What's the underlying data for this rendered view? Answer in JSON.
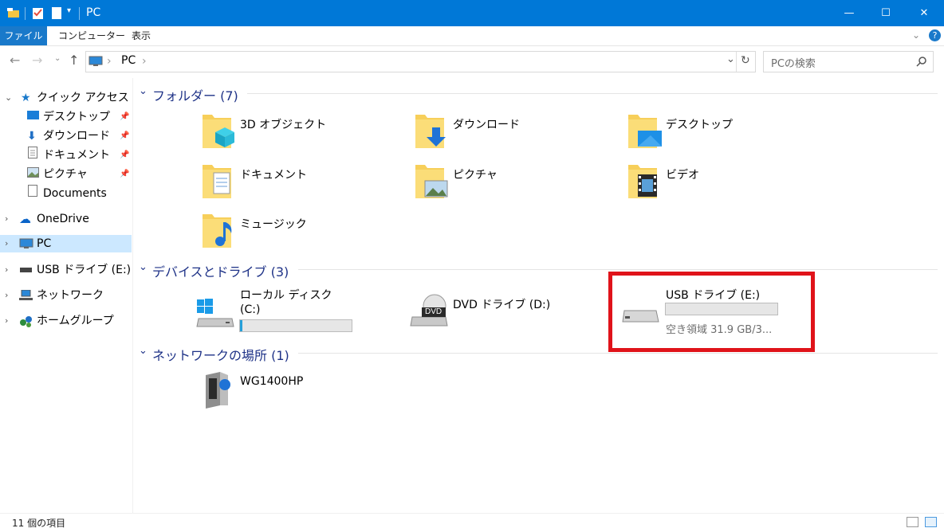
{
  "window": {
    "title": "PC",
    "minimize": "—",
    "maximize": "☐",
    "close": "✕"
  },
  "ribbon": {
    "tabs": [
      "ファイル",
      "コンピューター",
      "表示"
    ]
  },
  "address": {
    "location": "PC",
    "separator": "›",
    "search_placeholder": "PCの検索"
  },
  "nav": {
    "quick_access": "クイック アクセス",
    "items": [
      "デスクトップ",
      "ダウンロード",
      "ドキュメント",
      "ピクチャ",
      "Documents"
    ],
    "onedrive": "OneDrive",
    "pc": "PC",
    "usb": "USB ドライブ (E:)",
    "network": "ネットワーク",
    "homegroup": "ホームグループ"
  },
  "groups": {
    "folders_header": "フォルダー (7)",
    "devices_header": "デバイスとドライブ (3)",
    "network_header": "ネットワークの場所 (1)"
  },
  "folders": [
    "3D オブジェクト",
    "ダウンロード",
    "デスクトップ",
    "ドキュメント",
    "ピクチャ",
    "ビデオ",
    "ミュージック"
  ],
  "drives": {
    "local_name": "ローカル ディスク",
    "local_letter": "(C:)",
    "local_fill_pct": 2,
    "dvd_name": "DVD ドライブ (D:)",
    "dvd_badge": "DVD",
    "usb_name": "USB ドライブ (E:)",
    "usb_free": "空き領域 31.9 GB/3...",
    "usb_fill_pct": 0
  },
  "network_locations": [
    "WG1400HP"
  ],
  "status": {
    "count": "11 個の項目"
  },
  "colors": {
    "accent": "#0078d7",
    "highlight": "#e0131a",
    "header": "#1e3287",
    "selected": "#cce8ff"
  }
}
